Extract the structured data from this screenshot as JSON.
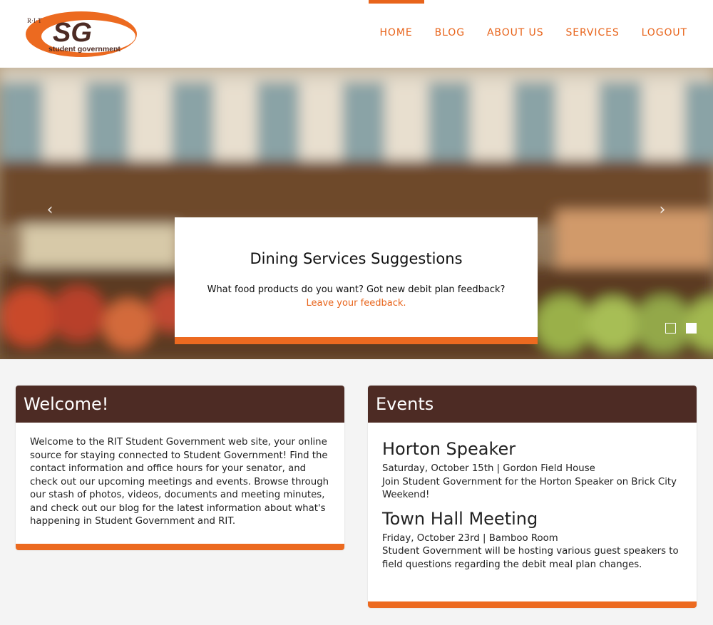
{
  "header": {
    "logo": {
      "top_text": "R·I·T",
      "letters": "SG",
      "subtitle": "student government"
    },
    "nav": [
      {
        "label": "HOME",
        "active": true
      },
      {
        "label": "BLOG"
      },
      {
        "label": "ABOUT US"
      },
      {
        "label": "SERVICES"
      },
      {
        "label": "LOGOUT"
      }
    ]
  },
  "hero": {
    "prev_icon": "chevron-left-icon",
    "next_icon": "chevron-right-icon",
    "caption": {
      "title": "Dining Services Suggestions",
      "text": "What food products do you want? Got new debit plan feedback?",
      "link": "Leave your feedback."
    },
    "slide_count": 2,
    "active_slide": 2
  },
  "welcome": {
    "title": "Welcome!",
    "text": "Welcome to the RIT Student Government web site, your online source for staying connected to Student Government! Find the contact information and office hours for your senator, and check out our upcoming meetings and events. Browse through our stash of photos, videos, documents and meeting minutes, and check out our blog for the latest information about what's happening in Student Government and RIT."
  },
  "events": {
    "title": "Events",
    "items": [
      {
        "title": "Horton Speaker",
        "meta": "Saturday, October 15th | Gordon Field House",
        "desc": "Join Student Government for the Horton Speaker on Brick City Weekend!"
      },
      {
        "title": "Town Hall Meeting",
        "meta": "Friday, October 23rd | Bamboo Room",
        "desc": "Student Government will be hosting various guest speakers to field questions regarding the debit meal plan changes."
      }
    ]
  },
  "colors": {
    "accent": "#e8641b",
    "panel_header": "#4d2b24",
    "background": "#f4f4f4"
  }
}
